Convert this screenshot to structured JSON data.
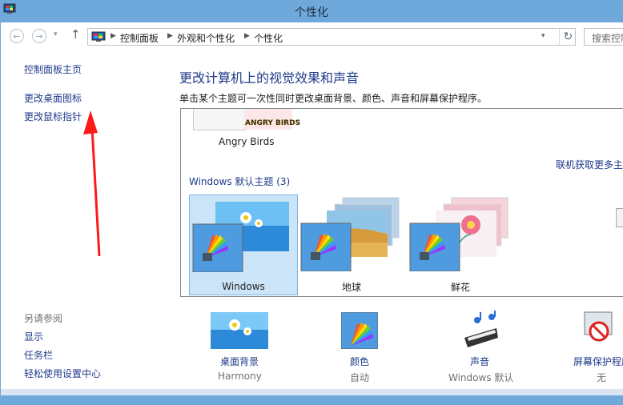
{
  "window": {
    "title": "个性化"
  },
  "nav": {
    "back": "←",
    "forward": "→",
    "dropdown": "▾",
    "up": "↑",
    "refresh": "↻",
    "addr_dropdown": "▾"
  },
  "breadcrumb": {
    "item1": "控制面板",
    "item2": "外观和个性化",
    "item3": "个性化",
    "sep": "▶"
  },
  "search": {
    "placeholder": "搜索控制面"
  },
  "sidebar": {
    "home": "控制面板主页",
    "desktop_icons": "更改桌面图标",
    "mouse_pointer": "更改鼠标指针",
    "see_also": "另请参阅",
    "display": "显示",
    "taskbar": "任务栏",
    "ease_of_access": "轻松使用设置中心"
  },
  "main": {
    "heading": "更改计算机上的视觉效果和声音",
    "description": "单击某个主题可一次性同时更改桌面背景、颜色、声音和屏幕保护程序。"
  },
  "themes": {
    "my_theme": "Angry Birds",
    "angry_birds_logo": "ANGRY BIRDS",
    "online_link": "联机获取更多主",
    "default_group": "Windows 默认主题 (3)",
    "default": [
      {
        "name": "Windows"
      },
      {
        "name": "地球"
      },
      {
        "name": "鲜花"
      }
    ]
  },
  "bottom": {
    "background": {
      "label": "桌面背景",
      "value": "Harmony"
    },
    "color": {
      "label": "颜色",
      "value": "自动"
    },
    "sound": {
      "label": "声音",
      "value": "Windows 默认"
    },
    "screensaver": {
      "label": "屏幕保护程序",
      "value": "无"
    }
  },
  "colors": {
    "accent": "#6fa9dc",
    "link": "#1e3a8a",
    "selected": "#cce4f7",
    "arrow": "#ff1a1a"
  }
}
